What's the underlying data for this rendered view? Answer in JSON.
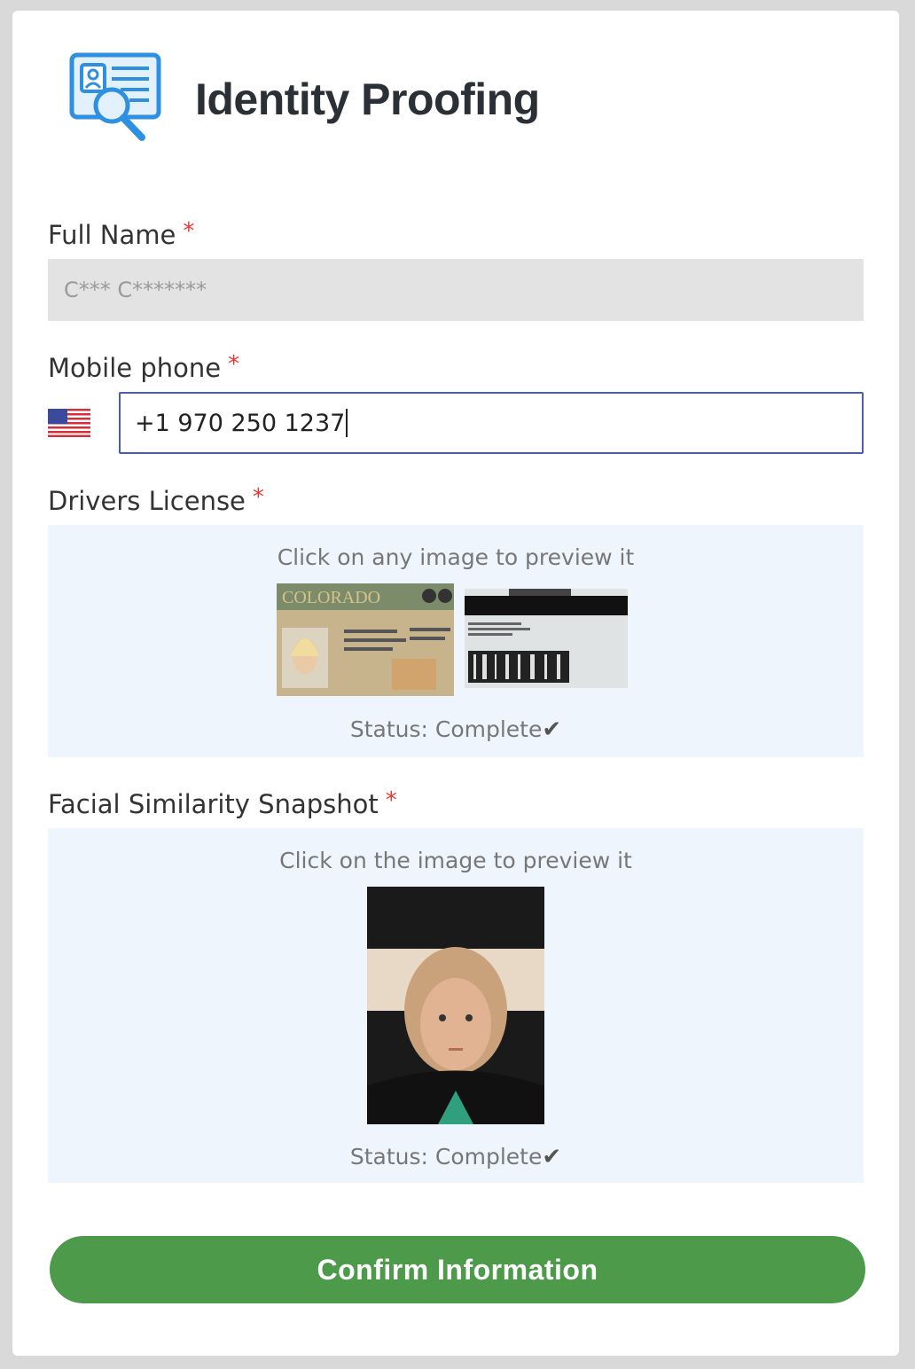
{
  "app": {
    "title": "Identity Proofing",
    "logo_icon": "id-card-search-icon"
  },
  "form": {
    "full_name": {
      "label": "Full Name",
      "required_mark": "*",
      "value": "C*** C*******"
    },
    "mobile_phone": {
      "label": "Mobile phone",
      "required_mark": "*",
      "value": "+1 970 250 1237",
      "flag_icon": "us-flag-icon"
    },
    "drivers_license": {
      "label": "Drivers License",
      "required_mark": "*",
      "hint": "Click on any image to preview it",
      "front_image_text": "COLORADO",
      "status": "Status: Complete",
      "status_icon": "checkmark-icon"
    },
    "facial_snapshot": {
      "label": "Facial Similarity Snapshot",
      "required_mark": "*",
      "hint": "Click on the image to preview it",
      "status": "Status: Complete",
      "status_icon": "checkmark-icon"
    },
    "confirm_label": "Confirm Information"
  },
  "colors": {
    "accent_green": "#4d9a4b",
    "required_red": "#e53935",
    "panel_bg": "#eef5fd",
    "input_border": "#4a5fa8"
  }
}
